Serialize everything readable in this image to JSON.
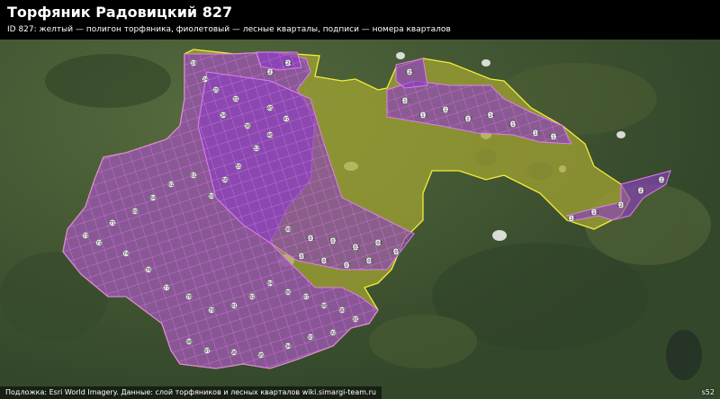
{
  "title": "Торфяник Радовицкий 827",
  "subtitle": "ID 827: желтый — полигон торфяника, фиолетовый — лесные кварталы, подписи — номера кварталов",
  "footer": "Подложка: Esri World Imagery. Данные: слой торфяников и лесных кварталов wiki.simargi-team.ru",
  "badge": "s52",
  "colors": {
    "peat_fill": "#a5a632",
    "peat_stroke": "#f2ee3a",
    "quarter_fill": "#8a3fc0",
    "quarter_stroke": "#e07ef0",
    "imagery": "#3d5433",
    "title_bg": "#000000"
  },
  "quarter_labels": [
    "19",
    "24",
    "25",
    "31",
    "34",
    "36",
    "45",
    "47",
    "48",
    "52",
    "55",
    "56",
    "59",
    "61",
    "62",
    "64",
    "69",
    "71",
    "72",
    "73",
    "74",
    "76",
    "77",
    "78",
    "79",
    "81",
    "82",
    "84",
    "86",
    "87",
    "88",
    "90",
    "91",
    "92",
    "93",
    "94",
    "95",
    "96",
    "97",
    "98",
    "99",
    "101",
    "102",
    "103",
    "104",
    "105",
    "106",
    "107",
    "108",
    "109",
    "110",
    "111",
    "112",
    "113",
    "114",
    "115",
    "116",
    "117",
    "118",
    "119",
    "120",
    "121",
    "122",
    "123",
    "124",
    "125"
  ],
  "label_order_note": ""
}
